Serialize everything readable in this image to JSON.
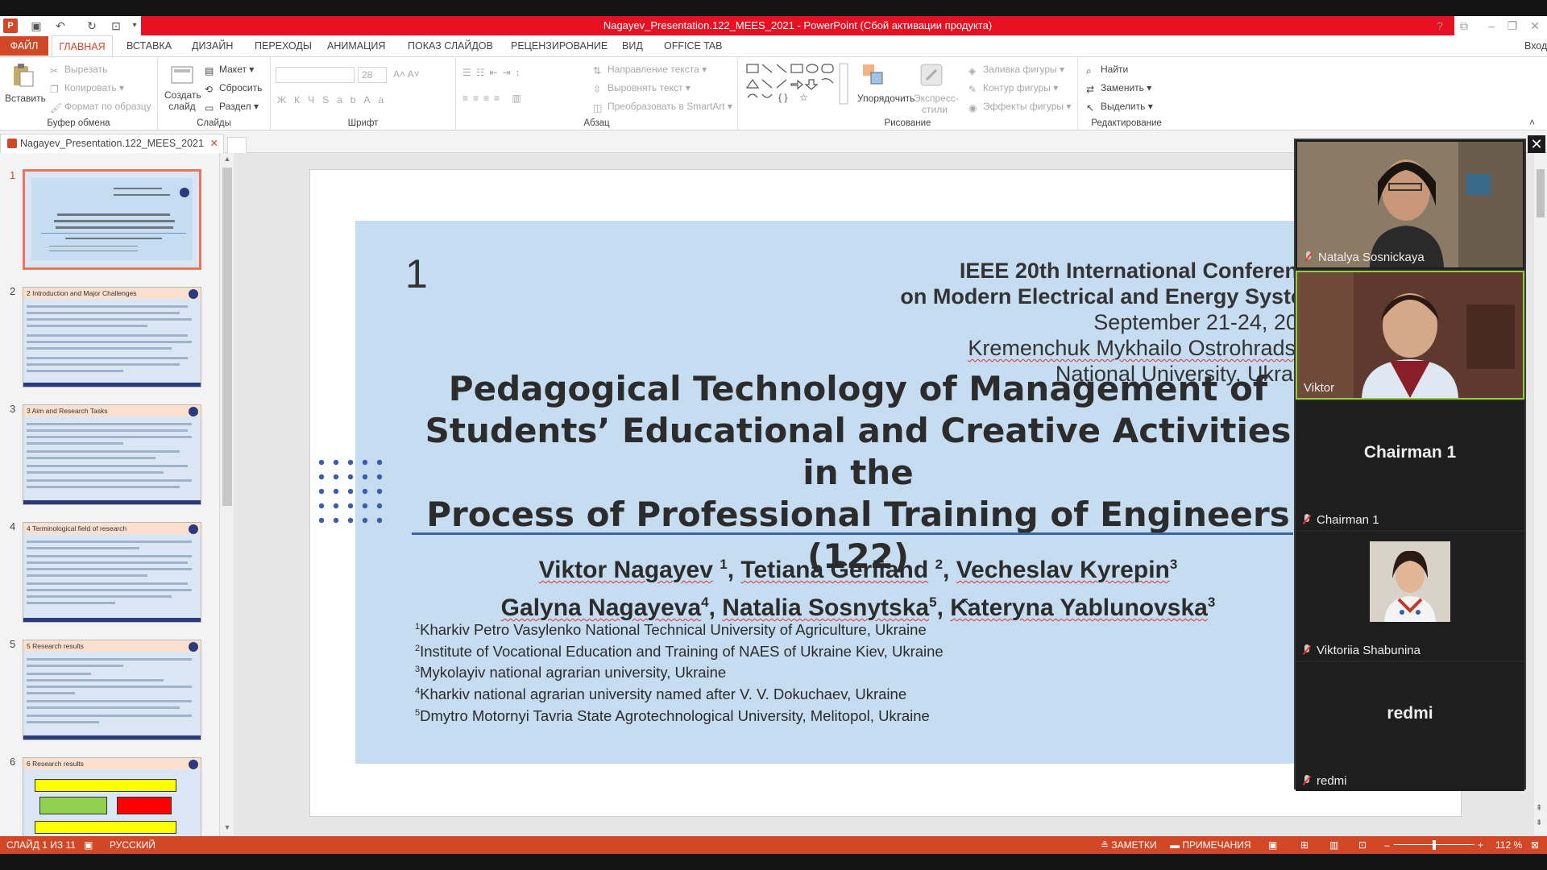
{
  "window": {
    "title": "Nagayev_Presentation.122_MEES_2021 - PowerPoint (Сбой активации продукта)",
    "signin": "Вход"
  },
  "ribbon_tabs": [
    "ФАЙЛ",
    "ГЛАВНАЯ",
    "ВСТАВКА",
    "ДИЗАЙН",
    "ПЕРЕХОДЫ",
    "АНИМАЦИЯ",
    "ПОКАЗ СЛАЙДОВ",
    "РЕЦЕНЗИРОВАНИЕ",
    "ВИД",
    "OFFICE TAB"
  ],
  "ribbon": {
    "clipboard": {
      "label": "Буфер обмена",
      "paste": "Вставить",
      "cut": "Вырезать",
      "copy": "Копировать",
      "format": "Формат по образцу"
    },
    "slides": {
      "label": "Слайды",
      "new_slide": "Создать слайд",
      "layout": "Макет",
      "reset": "Сбросить",
      "section": "Раздел"
    },
    "font": {
      "label": "Шрифт",
      "size": "28"
    },
    "paragraph": {
      "label": "Абзац",
      "text_dir": "Направление текста",
      "align_text": "Выровнять текст",
      "smartart": "Преобразовать в SmartArt"
    },
    "drawing": {
      "label": "Рисование",
      "arrange": "Упорядочить",
      "styles": "Экспресс-стили",
      "fill": "Заливка фигуры",
      "outline": "Контур фигуры",
      "effects": "Эффекты фигуры"
    },
    "editing": {
      "label": "Редактирование",
      "find": "Найти",
      "replace": "Заменить",
      "select": "Выделить"
    }
  },
  "doc_tab": {
    "name": "Nagayev_Presentation.122_MEES_2021"
  },
  "thumbnails": [
    {
      "num": "1",
      "title": ""
    },
    {
      "num": "2",
      "title": "2 Introduction and Major Challenges"
    },
    {
      "num": "3",
      "title": "3 Aim and Research Tasks"
    },
    {
      "num": "4",
      "title": "4 Terminological field of research"
    },
    {
      "num": "5",
      "title": "5 Research results"
    },
    {
      "num": "6",
      "title": "6 Research results"
    }
  ],
  "slide": {
    "number": "1",
    "conf_line1": "IEEE 20th International Conference",
    "conf_line2": "on Modern Electrical and Energy System",
    "conf_line3": "September 21-24, 2021",
    "conf_line4": "Kremenchuk Mykhailo Ostrohradskyi",
    "conf_line5": "National University, Ukraine",
    "title_line1": "Pedagogical Technology of Management of",
    "title_line2": "Students’ Educational and Creative Activities in the",
    "title_line3": "Process of Professional Training of Engineers (122)",
    "authors": [
      {
        "name": "Viktor Nagayev",
        "sup": "1"
      },
      {
        "name": "Tetiana Gerliand",
        "sup": "2"
      },
      {
        "name": "Vecheslav Kyrepin",
        "sup": "3"
      },
      {
        "name": "Galyna Nagayeva",
        "sup": "4"
      },
      {
        "name": "Natalia Sosnytska",
        "sup": "5"
      },
      {
        "name": "Kateryna Yablunovska",
        "sup": "3"
      }
    ],
    "affiliations": [
      {
        "sup": "1",
        "text": "Kharkiv Petro Vasylenko National Technical University of Agriculture, Ukraine"
      },
      {
        "sup": "2",
        "text": "Institute of Vocational Education and Training of NAES of Ukraine Kiev, Ukraine"
      },
      {
        "sup": "3",
        "text": "Mykolayiv national agrarian university, Ukraine"
      },
      {
        "sup": "4",
        "text": "Kharkiv national agrarian university named after V. V. Dokuchaev, Ukraine"
      },
      {
        "sup": "5",
        "text": "Dmytro Motornyi Tavria State Agrotechnological University, Melitopol, Ukraine"
      }
    ]
  },
  "participants": [
    {
      "name": "Natalya Sosnickaya",
      "center": ""
    },
    {
      "name": "Viktor",
      "center": ""
    },
    {
      "name": "Chairman 1",
      "center": "Chairman 1"
    },
    {
      "name": "Viktoriia Shabunina",
      "center": ""
    },
    {
      "name": "redmi",
      "center": "redmi"
    }
  ],
  "statusbar": {
    "slide": "СЛАЙД 1 ИЗ 11",
    "lang": "РУССКИЙ",
    "notes": "ЗАМЕТКИ",
    "comments": "ПРИМЕЧАНИЯ",
    "zoom": "112 %"
  },
  "colors": {
    "accent": "#d24726",
    "title_red": "#e81123",
    "slide_bg": "#c5dcf1"
  }
}
